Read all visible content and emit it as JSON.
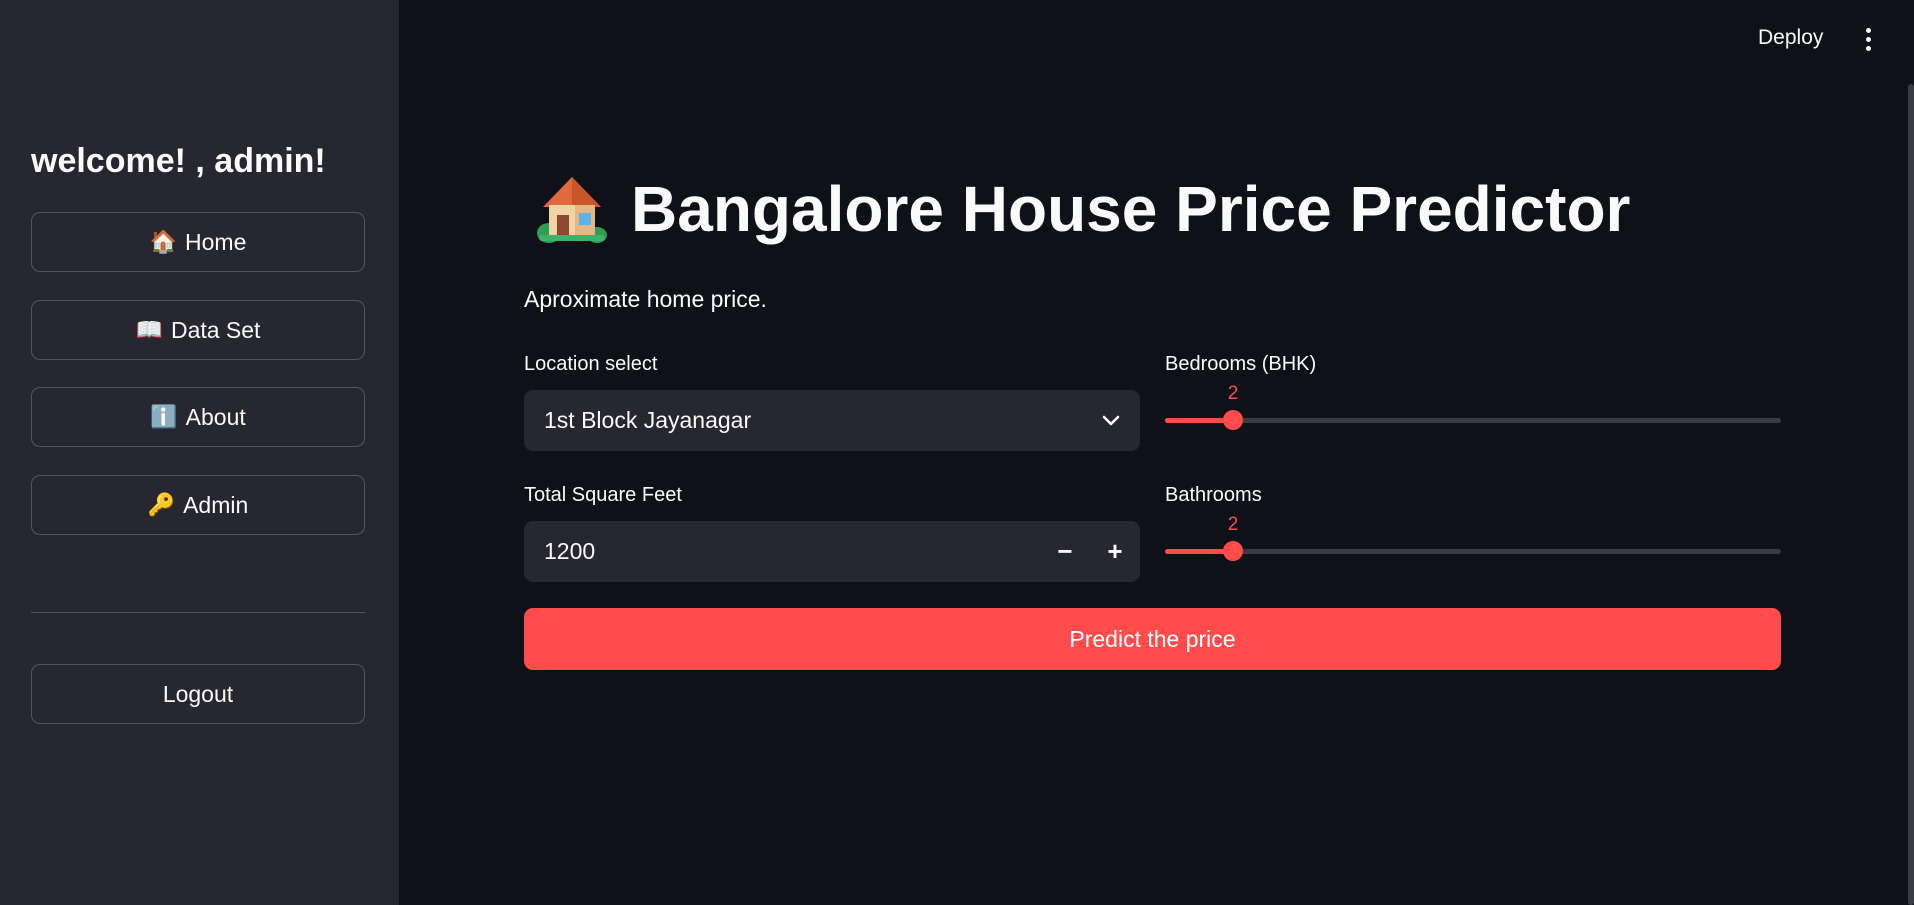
{
  "sidebar": {
    "welcome": "welcome! , admin!",
    "nav": [
      {
        "icon": "🏠",
        "icon_name": "house-icon",
        "label": "Home"
      },
      {
        "icon": "📖",
        "icon_name": "open-book-icon",
        "label": "Data Set"
      },
      {
        "icon": "ℹ️",
        "icon_name": "info-icon",
        "label": "About"
      },
      {
        "icon": "🔑",
        "icon_name": "key-icon",
        "label": "Admin"
      }
    ],
    "logout_label": "Logout"
  },
  "header": {
    "deploy_label": "Deploy",
    "menu_icon": "vertical-dots-icon"
  },
  "main": {
    "title_icon": "house-with-garden-icon",
    "title": "Bangalore House Price Predictor",
    "subtitle": "Aproximate home price.",
    "location": {
      "label": "Location select",
      "value": "1st Block Jayanagar"
    },
    "sqft": {
      "label": "Total Square Feet",
      "value": "1200",
      "minus": "−",
      "plus": "+"
    },
    "bedrooms": {
      "label": "Bedrooms (BHK)",
      "value": "2",
      "fraction": 0.111
    },
    "bathrooms": {
      "label": "Bathrooms",
      "value": "2",
      "fraction": 0.111
    },
    "predict_label": "Predict the price"
  },
  "colors": {
    "background": "#0e1117",
    "sidebar": "#262730",
    "accent": "#ff4b4b",
    "text": "#fafafa"
  }
}
